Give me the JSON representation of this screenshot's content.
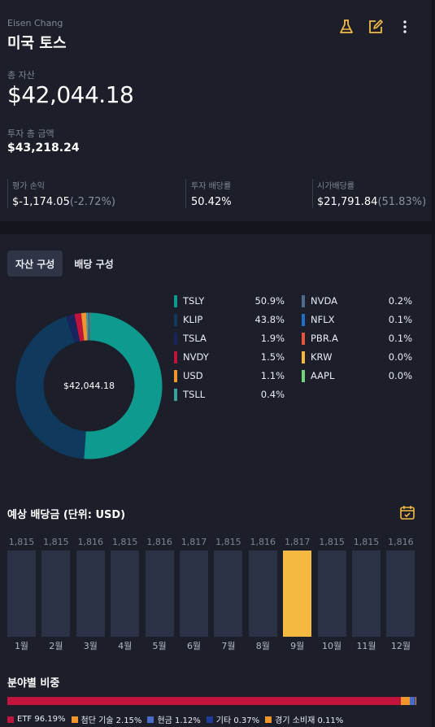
{
  "header": {
    "owner": "Eisen Chang",
    "account_name": "미국 토스"
  },
  "summary": {
    "total_label": "총 자산",
    "total_value": "$42,044.18",
    "invest_label": "투자 총 금액",
    "invest_value": "$43,218.24",
    "stats": [
      {
        "label": "평가 손익",
        "value": "$-1,174.05",
        "sub": "(-2.72%)"
      },
      {
        "label": "투자 배당률",
        "value": "50.42%",
        "sub": ""
      },
      {
        "label": "시가배당률",
        "value": "$21,791.84",
        "sub": "(51.83%)"
      }
    ]
  },
  "tabs": [
    {
      "label": "자산 구성",
      "active": true
    },
    {
      "label": "배당 구성",
      "active": false
    }
  ],
  "composition": {
    "center_value": "$42,044.18",
    "items": [
      {
        "name": "TSLY",
        "pct": "50.9%",
        "value": 50.9,
        "color": "#0e9a8f"
      },
      {
        "name": "KLIP",
        "pct": "43.8%",
        "value": 43.8,
        "color": "#0f3a5e"
      },
      {
        "name": "TSLA",
        "pct": "1.9%",
        "value": 1.9,
        "color": "#17245e"
      },
      {
        "name": "NVDY",
        "pct": "1.5%",
        "value": 1.5,
        "color": "#c0143c"
      },
      {
        "name": "USD",
        "pct": "1.1%",
        "value": 1.1,
        "color": "#f0952c"
      },
      {
        "name": "TSLL",
        "pct": "0.4%",
        "value": 0.4,
        "color": "#39a29c"
      },
      {
        "name": "NVDA",
        "pct": "0.2%",
        "value": 0.2,
        "color": "#4f6b8e"
      },
      {
        "name": "NFLX",
        "pct": "0.1%",
        "value": 0.1,
        "color": "#1f6fc5"
      },
      {
        "name": "PBR.A",
        "pct": "0.1%",
        "value": 0.1,
        "color": "#e8533a"
      },
      {
        "name": "KRW",
        "pct": "0.0%",
        "value": 0.0,
        "color": "#f6b73c"
      },
      {
        "name": "AAPL",
        "pct": "0.0%",
        "value": 0.0,
        "color": "#6fd47a"
      }
    ]
  },
  "dividends": {
    "title": "예상 배당금 (단위: USD)",
    "highlight_index": 8,
    "months": [
      {
        "label": "1월",
        "value": "1,815"
      },
      {
        "label": "2월",
        "value": "1,815"
      },
      {
        "label": "3월",
        "value": "1,816"
      },
      {
        "label": "4월",
        "value": "1,815"
      },
      {
        "label": "5월",
        "value": "1,816"
      },
      {
        "label": "6월",
        "value": "1,817"
      },
      {
        "label": "7월",
        "value": "1,815"
      },
      {
        "label": "8월",
        "value": "1,816"
      },
      {
        "label": "9월",
        "value": "1,817"
      },
      {
        "label": "10월",
        "value": "1,815"
      },
      {
        "label": "11월",
        "value": "1,815"
      },
      {
        "label": "12월",
        "value": "1,816"
      }
    ]
  },
  "sectors": {
    "title": "분야별 비중",
    "items": [
      {
        "label": "ETF 96.19%",
        "value": 96.19,
        "color": "#c0143c"
      },
      {
        "label": "첨단 기술 2.15%",
        "value": 2.15,
        "color": "#f0952c"
      },
      {
        "label": "현금 1.12%",
        "value": 1.12,
        "color": "#4a6cc8"
      },
      {
        "label": "기타 0.37%",
        "value": 0.37,
        "color": "#1e3a9a"
      },
      {
        "label": "경기 소비재 0.11%",
        "value": 0.11,
        "color": "#f0952c"
      }
    ]
  },
  "colors": {
    "accent": "#f5b942",
    "background": "#14161d",
    "card": "#1c1f2a"
  }
}
